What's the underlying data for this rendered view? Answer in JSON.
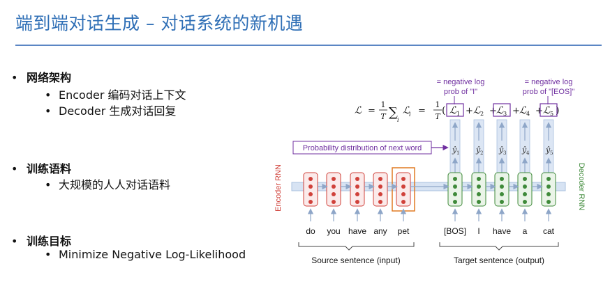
{
  "title": "端到端对话生成 – 对话系统的新机遇",
  "bullets": {
    "architecture": {
      "heading": "网络架构",
      "items": [
        "Encoder 编码对话上下文",
        "Decoder 生成对话回复"
      ]
    },
    "corpus": {
      "heading": "训练语料",
      "items": [
        "大规模的人人对话语料"
      ]
    },
    "objective": {
      "heading": "训练目标",
      "items": [
        "Minimize Negative Log-Likelihood"
      ]
    }
  },
  "diagram": {
    "annotation_left": [
      "= negative log",
      "prob of \"I\""
    ],
    "annotation_right": [
      "= negative log",
      "prob of \"[EOS]\""
    ],
    "formula": {
      "lhs": "ℒ",
      "eq": "=",
      "frac1_num": "1",
      "frac1_den": "T",
      "sum": "∑",
      "sum_sub": "i",
      "term": "ℒ",
      "term_sub": "i",
      "frac2_num": "1",
      "frac2_den": "T",
      "paren_open": "(",
      "paren_close": ")",
      "plus": "+",
      "loss_subs": [
        "1",
        "2",
        "3",
        "4",
        "5"
      ]
    },
    "prob_label": "Probability distribution of next word",
    "encoder_label": "Encoder RNN",
    "decoder_label": "Decoder RNN",
    "source_words": [
      "do",
      "you",
      "have",
      "any",
      "pet"
    ],
    "target_words": [
      "[BOS]",
      "I",
      "have",
      "a",
      "cat"
    ],
    "yhat_labels": [
      "ŷ",
      "ŷ",
      "ŷ",
      "ŷ",
      "ŷ"
    ],
    "yhat_subs": [
      "1",
      "2",
      "3",
      "4",
      "5"
    ],
    "source_caption": "Source sentence (input)",
    "target_caption": "Target sentence (output)",
    "colors": {
      "title": "#2f6fb6",
      "encoder": "#d0413a",
      "decoder": "#3f8a3a",
      "highlight": "#e07a22",
      "annotation": "#7030a0",
      "arrow": "#9bb4d6",
      "column": "#c5d6ec"
    }
  }
}
